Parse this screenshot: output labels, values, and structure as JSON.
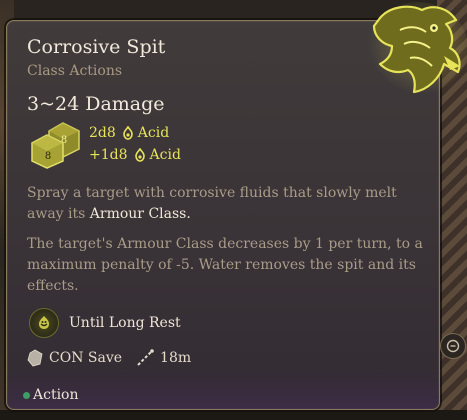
{
  "spell": {
    "title": "Corrosive Spit",
    "category": "Class Actions",
    "damage": "3~24 Damage",
    "rolls": [
      {
        "dice": "2d8",
        "type": "Acid"
      },
      {
        "dice": "+1d8",
        "type": "Acid"
      }
    ],
    "dice_faces": [
      "8",
      "8"
    ],
    "description_pre": "Spray a target with corrosive fluids that slowly melt away its",
    "description_highlight": "Armour Class.",
    "effect_text": "The target's Armour Class decreases by 1 per turn, to a maximum penalty of -5. Water removes the spit and its effects.",
    "duration": "Until Long Rest",
    "save": "CON Save",
    "range": "18m",
    "cost": "Action"
  },
  "colors": {
    "accent": "#e7e45a",
    "title": "#f1e9dc",
    "muted": "#a99c89",
    "action_dot": "#3e9c65",
    "border": "#8a7a5c"
  },
  "icons": {
    "dice": "d8-dice-icon",
    "acid": "acid-damage-icon",
    "duration": "condition-icon",
    "save": "saving-throw-icon",
    "range": "range-icon",
    "action": "action-resource-icon",
    "art": "spell-art-icon",
    "side": "zoom-out-icon"
  }
}
